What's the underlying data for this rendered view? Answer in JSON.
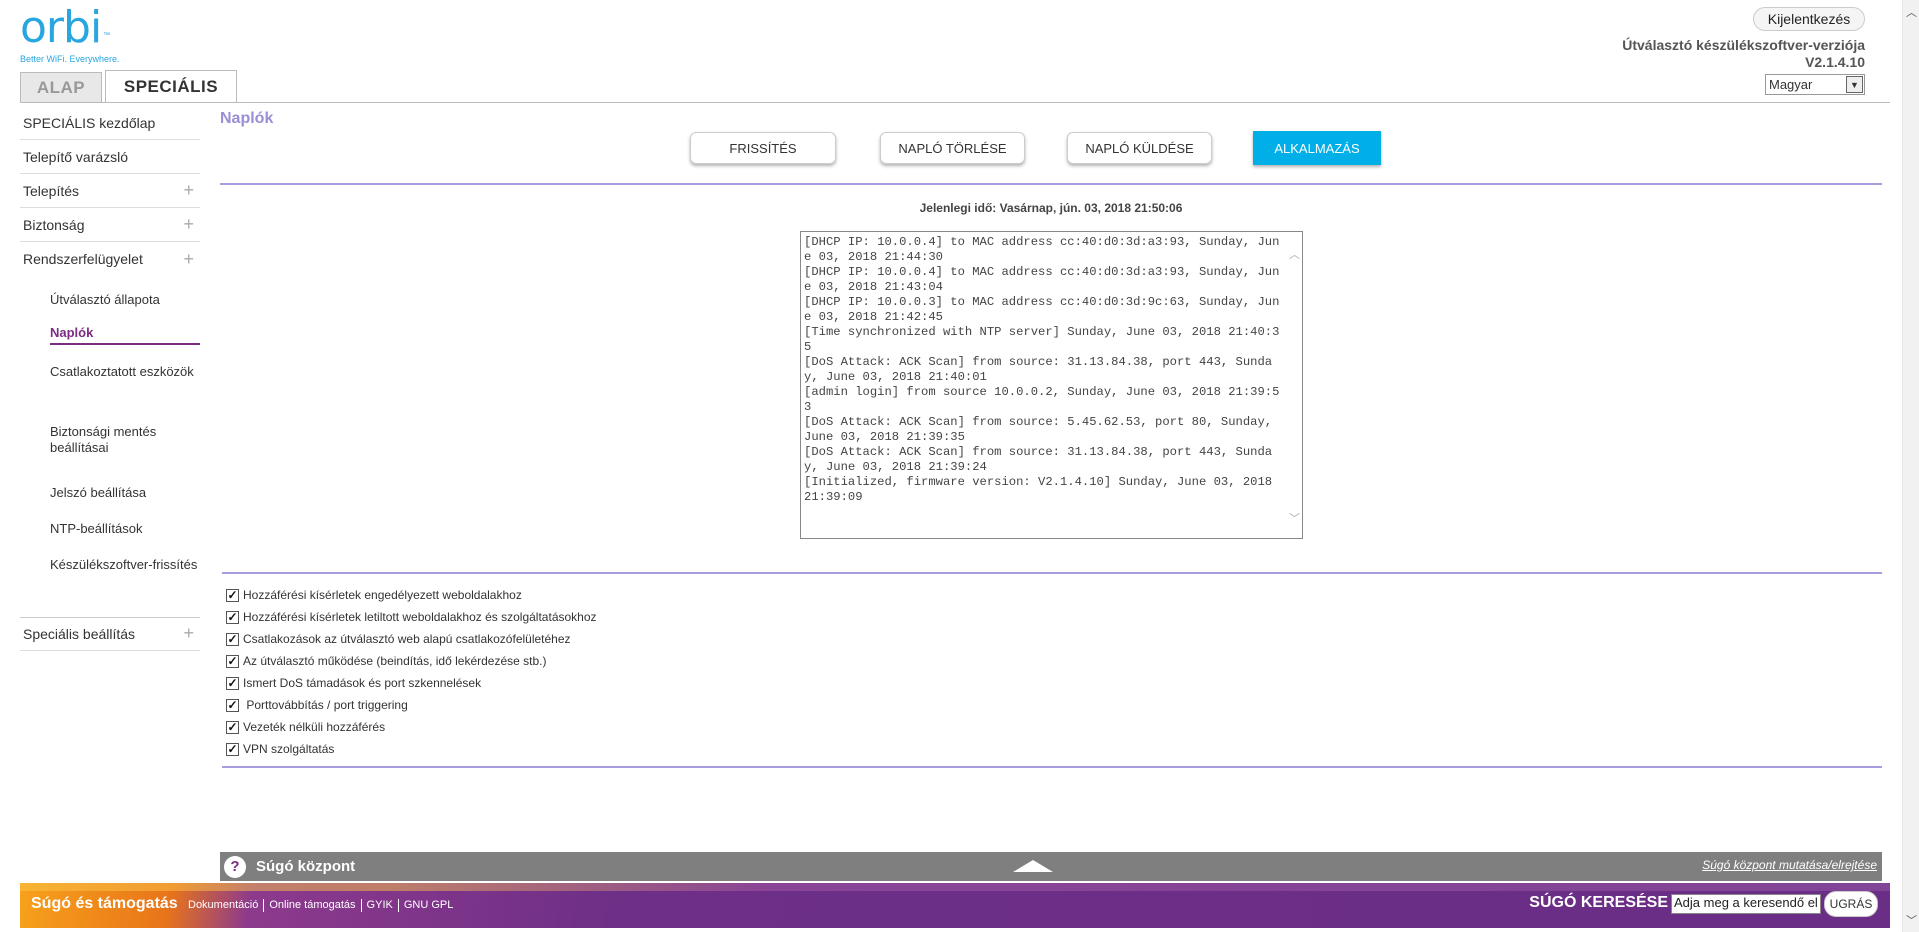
{
  "header": {
    "logo_text": "orbi",
    "logo_tm": "™",
    "logo_tagline": "Better WiFi. Everywhere.",
    "logout_label": "Kijelentkezés",
    "firmware_label": "Útválasztó készülékszoftver-verziója",
    "firmware_version": "V2.1.4.10",
    "language_selected": "Magyar"
  },
  "tabs": [
    {
      "label": "ALAP",
      "active": false
    },
    {
      "label": "SPECIÁLIS",
      "active": true
    }
  ],
  "sidebar": {
    "items": [
      {
        "label": "SPECIÁLIS kezdőlap"
      },
      {
        "label": "Telepítő varázsló"
      },
      {
        "label": "Telepítés",
        "expand": "+"
      },
      {
        "label": "Biztonság",
        "expand": "+"
      },
      {
        "label": "Rendszerfelügyelet",
        "expand": "+"
      }
    ],
    "subitems": [
      {
        "label": "Útválasztó állapota"
      },
      {
        "label": "Naplók",
        "active": true
      },
      {
        "label": "Csatlakoztatott eszközök"
      },
      {
        "label": "Biztonsági mentés beállításai"
      },
      {
        "label": "Jelszó beállítása"
      },
      {
        "label": "NTP-beállítások"
      },
      {
        "label": "Készülékszoftver-frissítés"
      }
    ],
    "bottom_item": {
      "label": "Speciális beállítás",
      "expand": "+"
    }
  },
  "main": {
    "title": "Naplók",
    "buttons": {
      "refresh": "FRISSÍTÉS",
      "clear": "NAPLÓ TÖRLÉSE",
      "send": "NAPLÓ KÜLDÉSE",
      "apply": "ALKALMAZÁS"
    },
    "current_time": "Jelenlegi idő: Vasárnap, jún. 03, 2018 21:50:06",
    "log_text": "[DHCP IP: 10.0.0.4] to MAC address cc:40:d0:3d:a3:93, Sunday, June 03, 2018 21:44:30\n[DHCP IP: 10.0.0.4] to MAC address cc:40:d0:3d:a3:93, Sunday, June 03, 2018 21:43:04\n[DHCP IP: 10.0.0.3] to MAC address cc:40:d0:3d:9c:63, Sunday, June 03, 2018 21:42:45\n[Time synchronized with NTP server] Sunday, June 03, 2018 21:40:35\n[DoS Attack: ACK Scan] from source: 31.13.84.38, port 443, Sunday, June 03, 2018 21:40:01\n[admin login] from source 10.0.0.2, Sunday, June 03, 2018 21:39:53\n[DoS Attack: ACK Scan] from source: 5.45.62.53, port 80, Sunday, June 03, 2018 21:39:35\n[DoS Attack: ACK Scan] from source: 31.13.84.38, port 443, Sunday, June 03, 2018 21:39:24\n[Initialized, firmware version: V2.1.4.10] Sunday, June 03, 2018 21:39:09",
    "checkboxes": [
      {
        "label": "Hozzáférési kísérletek engedélyezett weboldalakhoz",
        "checked": true
      },
      {
        "label": "Hozzáférési kísérletek letiltott weboldalakhoz és szolgáltatásokhoz",
        "checked": true
      },
      {
        "label": "Csatlakozások az útválasztó web alapú csatlakozófelületéhez",
        "checked": true
      },
      {
        "label": "Az útválasztó működése (beindítás, idő lekérdezése stb.)",
        "checked": true
      },
      {
        "label": "Ismert DoS támadások és port szkennelések",
        "checked": true
      },
      {
        "label": " Porttovábbítás / port triggering",
        "checked": true
      },
      {
        "label": "Vezeték nélküli hozzáférés",
        "checked": true
      },
      {
        "label": "VPN szolgáltatás",
        "checked": true
      }
    ]
  },
  "help": {
    "icon": "?",
    "title": "Súgó központ",
    "toggle_label": "Súgó központ mutatása/elrejtése"
  },
  "footer": {
    "title": "Súgó és támogatás",
    "links": [
      "Dokumentáció",
      "Online támogatás",
      "GYIK",
      "GNU GPL"
    ],
    "search_label": "SÚGÓ KERESÉSE",
    "search_value": "Adja meg a keresendő el",
    "search_button": "UGRÁS"
  },
  "colors": {
    "accent_blue": "#00aee8",
    "brand_purple": "#7b2c83",
    "title_lavender": "#9b8dd6"
  }
}
